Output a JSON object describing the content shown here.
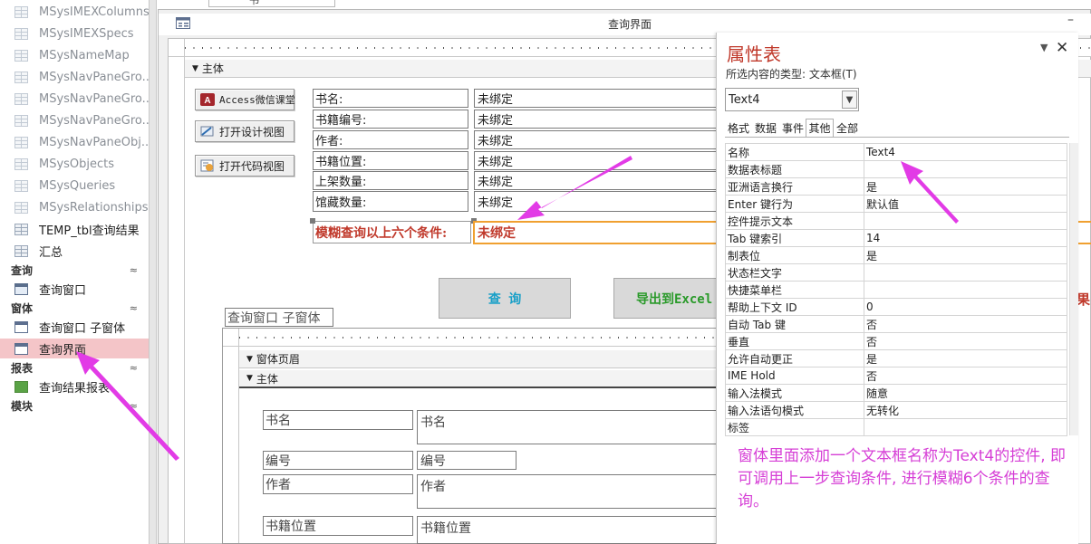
{
  "nav": {
    "tables": [
      {
        "label": "MSysIMEXColumns",
        "system": true
      },
      {
        "label": "MSysIMEXSpecs",
        "system": true
      },
      {
        "label": "MSysNameMap",
        "system": true
      },
      {
        "label": "MSysNavPaneGro...",
        "system": true
      },
      {
        "label": "MSysNavPaneGro...",
        "system": true
      },
      {
        "label": "MSysNavPaneGro...",
        "system": true
      },
      {
        "label": "MSysNavPaneObj...",
        "system": true
      },
      {
        "label": "MSysObjects",
        "system": true
      },
      {
        "label": "MSysQueries",
        "system": true
      },
      {
        "label": "MSysRelationships",
        "system": true
      },
      {
        "label": "TEMP_tbl查询结果",
        "system": false
      },
      {
        "label": "汇总",
        "system": false
      }
    ],
    "groups": {
      "queries": {
        "label": "查询",
        "chevron": "≈",
        "items": [
          "查询窗口"
        ]
      },
      "forms": {
        "label": "窗体",
        "chevron": "≈",
        "items": [
          "查询窗口 子窗体",
          "查询界面"
        ]
      },
      "reports": {
        "label": "报表",
        "chevron": "≈",
        "items": [
          "查询结果报表"
        ]
      },
      "modules": {
        "label": "模块",
        "chevron": "≈"
      }
    },
    "selected_item": "查询界面"
  },
  "document": {
    "title": "查询界面",
    "minimize_glyph": "–",
    "top_tab_label": "书"
  },
  "form": {
    "section_label": "主体",
    "buttons": {
      "wechat": "Access微信课堂",
      "design_view": "打开设计视图",
      "code_view": "打开代码视图"
    },
    "fields": [
      {
        "label": "书名:",
        "value": "未绑定"
      },
      {
        "label": "书籍编号:",
        "value": "未绑定"
      },
      {
        "label": "作者:",
        "value": "未绑定"
      },
      {
        "label": "书籍位置:",
        "value": "未绑定"
      },
      {
        "label": "上架数量:",
        "value": "未绑定"
      },
      {
        "label": "馆藏数量:",
        "value": "未绑定"
      }
    ],
    "fuzzy": {
      "label": "模糊查询以上六个条件:",
      "value": "未绑定"
    },
    "query_button": "查 询",
    "export_button": "导出到Excel",
    "right_clip_char": "果",
    "subform": {
      "caption": "查询窗口 子窗体",
      "header_label": "窗体页眉",
      "section_label": "主体",
      "rows": [
        {
          "label": "书名",
          "value": "书名"
        },
        {
          "label": "编号",
          "value": "编号"
        },
        {
          "label": "作者",
          "value": "作者"
        },
        {
          "label": "书籍位置",
          "value": "书籍位置"
        }
      ]
    }
  },
  "property_sheet": {
    "title": "属性表",
    "selection_type": "所选内容的类型: 文本框(T)",
    "selected_control": "Text4",
    "tabs": [
      "格式",
      "数据",
      "事件",
      "其他",
      "全部"
    ],
    "active_tab": "其他",
    "properties": [
      {
        "name": "名称",
        "value": "Text4"
      },
      {
        "name": "数据表标题",
        "value": ""
      },
      {
        "name": "亚洲语言换行",
        "value": "是"
      },
      {
        "name": "Enter 键行为",
        "value": "默认值"
      },
      {
        "name": "控件提示文本",
        "value": ""
      },
      {
        "name": "Tab 键索引",
        "value": "14"
      },
      {
        "name": "制表位",
        "value": "是"
      },
      {
        "name": "状态栏文字",
        "value": ""
      },
      {
        "name": "快捷菜单栏",
        "value": ""
      },
      {
        "name": "帮助上下文 ID",
        "value": "0"
      },
      {
        "name": "自动 Tab 键",
        "value": "否"
      },
      {
        "name": "垂直",
        "value": "否"
      },
      {
        "name": "允许自动更正",
        "value": "是"
      },
      {
        "name": "IME Hold",
        "value": "否"
      },
      {
        "name": "输入法模式",
        "value": "随意"
      },
      {
        "name": "输入法语句模式",
        "value": "无转化"
      },
      {
        "name": "标签",
        "value": ""
      }
    ]
  },
  "annotation": "窗体里面添加一个文本框名称为Text4的控件, 即可调用上一步查询条件, 进行模糊6个条件的查询。",
  "colors": {
    "accent_red": "#c0392b",
    "annotation_magenta": "#d63fd6",
    "arrow_magenta": "#e23be6",
    "selection_orange": "#f0a030",
    "nav_selected": "#f4c5c8",
    "query_button_text": "#1aa0c8",
    "export_button_text": "#2a9a2a"
  }
}
